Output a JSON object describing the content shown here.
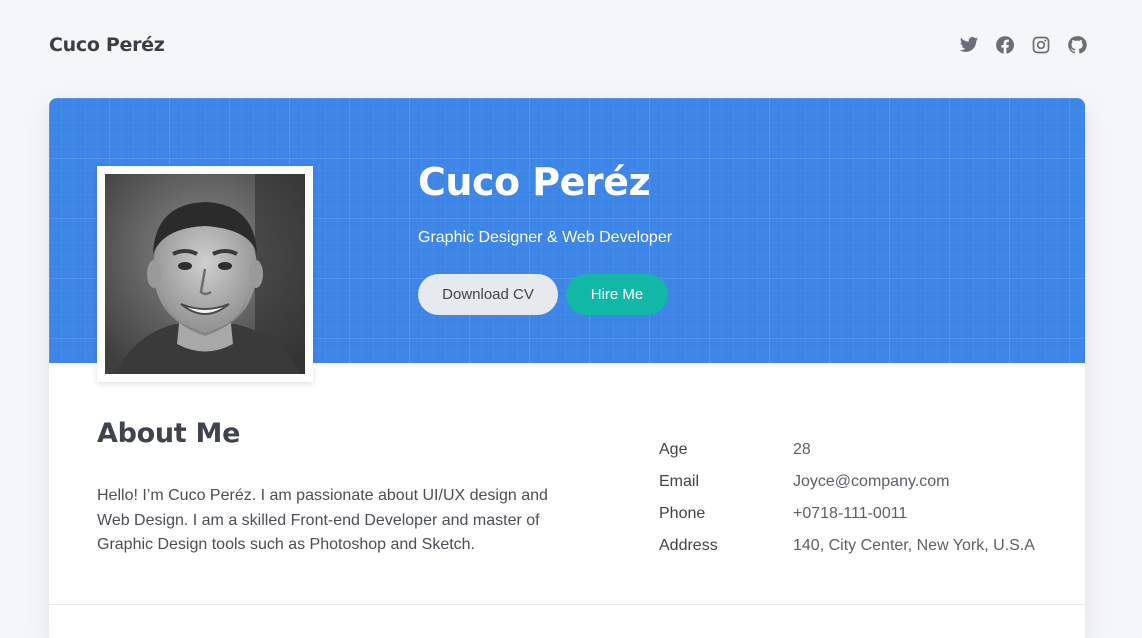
{
  "header": {
    "brand": "Cuco Peréz",
    "socials": [
      {
        "icon": "twitter-icon"
      },
      {
        "icon": "facebook-icon"
      },
      {
        "icon": "instagram-icon"
      },
      {
        "icon": "github-icon"
      }
    ]
  },
  "hero": {
    "name": "Cuco Peréz",
    "role": "Graphic Designer & Web Developer",
    "download_label": "Download CV",
    "hire_label": "Hire Me"
  },
  "about": {
    "title": "About Me",
    "text": "Hello! I’m Cuco Peréz. I am passionate about UI/UX design and Web Design. I am a skilled Front-end Developer and master of Graphic Design tools such as Photoshop and Sketch.",
    "info": [
      {
        "label": "Age",
        "value": "28"
      },
      {
        "label": "Email",
        "value": "Joyce@company.com"
      },
      {
        "label": "Phone",
        "value": "+0718-111-0011"
      },
      {
        "label": "Address",
        "value": "140, City Center, New York, U.S.A"
      }
    ]
  },
  "colors": {
    "hero_blue": "#3d86e8",
    "accent_teal": "#12b8a6",
    "page_bg": "#f5f6f8"
  }
}
